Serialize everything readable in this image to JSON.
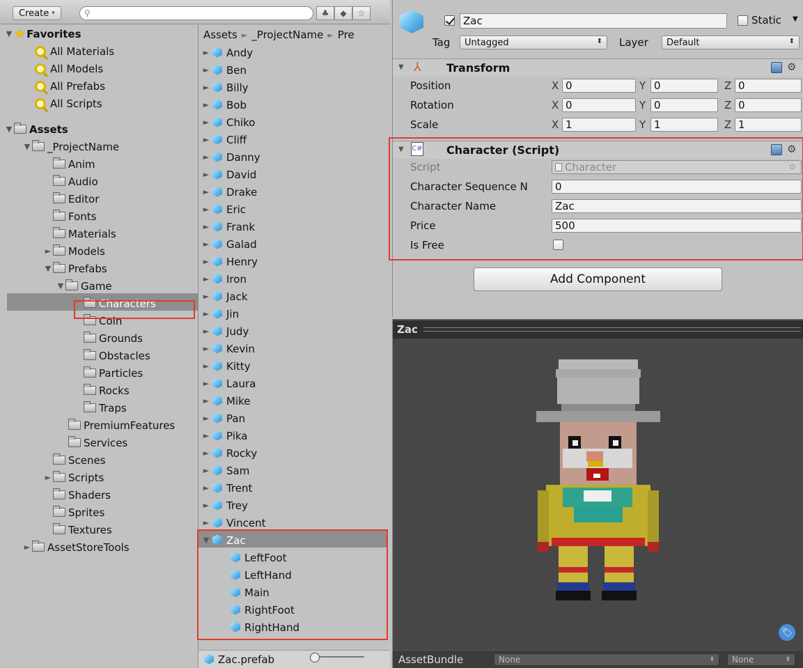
{
  "project": {
    "create_label": "Create",
    "search_placeholder": "",
    "tree": {
      "favorites": "Favorites",
      "fav_items": [
        "All Materials",
        "All Models",
        "All Prefabs",
        "All Scripts"
      ],
      "assets": "Assets",
      "project_name": "_ProjectName",
      "level2": [
        "Anim",
        "Audio",
        "Editor",
        "Fonts",
        "Materials",
        "Models",
        "Prefabs"
      ],
      "game": "Game",
      "game_children": [
        "Characters",
        "Coin",
        "Grounds",
        "Obstacles",
        "Particles",
        "Rocks",
        "Traps"
      ],
      "after_game": [
        "PremiumFeatures",
        "Services"
      ],
      "level2_rest": [
        "Scenes",
        "Scripts",
        "Shaders",
        "Sprites",
        "Textures"
      ],
      "asset_store_tools": "AssetStoreTools"
    },
    "breadcrumb": [
      "Assets",
      "_ProjectName",
      "Pre"
    ],
    "prefabs": [
      "Andy",
      "Ben",
      "Billy",
      "Bob",
      "Chiko",
      "Cliff",
      "Danny",
      "David",
      "Drake",
      "Eric",
      "Frank",
      "Galad",
      "Henry",
      "Iron",
      "Jack",
      "Jin",
      "Judy",
      "Kevin",
      "Kitty",
      "Laura",
      "Mike",
      "Pan",
      "Pika",
      "Rocky",
      "Sam",
      "Trent",
      "Trey",
      "Vincent",
      "Zac"
    ],
    "zac_children": [
      "LeftFoot",
      "LeftHand",
      "Main",
      "RightFoot",
      "RightHand"
    ],
    "selected_file": "Zac.prefab"
  },
  "inspector": {
    "object_name": "Zac",
    "static_label": "Static",
    "tag_label": "Tag",
    "tag_value": "Untagged",
    "layer_label": "Layer",
    "layer_value": "Default",
    "transform": {
      "title": "Transform",
      "rows": [
        {
          "label": "Position",
          "x": "0",
          "y": "0",
          "z": "0"
        },
        {
          "label": "Rotation",
          "x": "0",
          "y": "0",
          "z": "0"
        },
        {
          "label": "Scale",
          "x": "1",
          "y": "1",
          "z": "1"
        }
      ],
      "axis_x": "X",
      "axis_y": "Y",
      "axis_z": "Z"
    },
    "script_component": {
      "title": "Character (Script)",
      "script_label": "Script",
      "script_value": "Character",
      "fields": [
        {
          "label": "Character Sequence N",
          "value": "0"
        },
        {
          "label": "Character Name",
          "value": "Zac"
        },
        {
          "label": "Price",
          "value": "500"
        }
      ],
      "is_free_label": "Is Free"
    },
    "add_component": "Add Component"
  },
  "preview": {
    "title": "Zac",
    "assetbundle_label": "AssetBundle",
    "bundle_name": "None",
    "bundle_variant": "None"
  },
  "colors": {
    "highlight": "#e23a2c",
    "selection": "#8e8e8e"
  }
}
